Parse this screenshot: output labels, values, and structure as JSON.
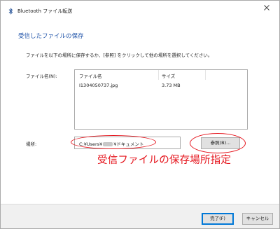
{
  "window": {
    "title": "Bluetooth ファイル転送",
    "close_symbol": "✕"
  },
  "heading": "受信したファイルの保存",
  "instruction": "ファイルを以下の場所に保存するか、[参照] をクリックして他の場所を選択してください。",
  "file_list": {
    "label": "ファイル名(N):",
    "columns": [
      "ファイル名",
      "サイズ"
    ],
    "rows": [
      {
        "name": "I1304050737.jpg",
        "size": "3.73 MB"
      }
    ]
  },
  "location": {
    "label": "場所:",
    "value_prefix": "C:¥Users¥",
    "value_suffix": "¥ドキュメント"
  },
  "browse_label": "参照(B)...",
  "annotation_text": "受信ファイルの保存場所指定",
  "buttons": {
    "done": "完了(F)",
    "cancel": "キャンセル"
  },
  "colors": {
    "heading": "#1e52a8",
    "annotation": "#e5141c",
    "default_button_border": "#0078d7"
  },
  "icons": {
    "title_icon": "bluetooth-icon",
    "close_icon": "close-icon"
  }
}
